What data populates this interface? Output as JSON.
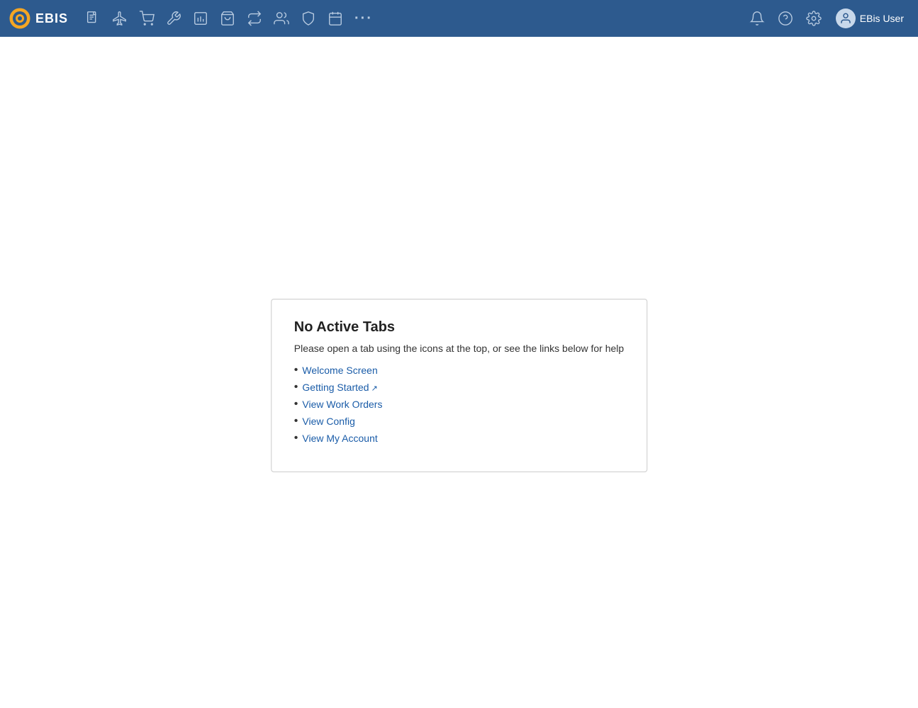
{
  "app": {
    "name": "EBIS"
  },
  "navbar": {
    "logo_text": "EBIS",
    "icons": [
      {
        "name": "document-icon",
        "unicode": "📋",
        "label": "Documents"
      },
      {
        "name": "flight-icon",
        "unicode": "✈",
        "label": "Flight"
      },
      {
        "name": "cart-icon",
        "unicode": "🛒",
        "label": "Cart"
      },
      {
        "name": "wrench-icon",
        "unicode": "🔧",
        "label": "Wrench"
      },
      {
        "name": "report-icon",
        "unicode": "📊",
        "label": "Reports"
      },
      {
        "name": "orders-icon",
        "unicode": "🛒",
        "label": "Orders"
      },
      {
        "name": "transfer-icon",
        "unicode": "⇄",
        "label": "Transfer"
      },
      {
        "name": "users-icon",
        "unicode": "👥",
        "label": "Users"
      },
      {
        "name": "shield-icon",
        "unicode": "🛡",
        "label": "Shield"
      },
      {
        "name": "calendar-icon",
        "unicode": "📅",
        "label": "Calendar"
      },
      {
        "name": "more-icon",
        "unicode": "···",
        "label": "More"
      }
    ],
    "right_icons": [
      {
        "name": "bell-icon",
        "unicode": "🔔",
        "label": "Notifications"
      },
      {
        "name": "help-icon",
        "unicode": "❓",
        "label": "Help"
      },
      {
        "name": "settings-icon",
        "unicode": "⚙",
        "label": "Settings"
      }
    ],
    "user": {
      "name": "EBis User",
      "avatar_icon": "person-icon"
    }
  },
  "main": {
    "card": {
      "title": "No Active Tabs",
      "description": "Please open a tab using the icons at the top, or see the links below for help",
      "links": [
        {
          "label": "Welcome Screen",
          "href": "#",
          "external": false
        },
        {
          "label": "Getting Started",
          "href": "#",
          "external": true
        },
        {
          "label": "View Work Orders",
          "href": "#",
          "external": false
        },
        {
          "label": "View Config",
          "href": "#",
          "external": false
        },
        {
          "label": "View My Account",
          "href": "#",
          "external": false
        }
      ]
    }
  }
}
